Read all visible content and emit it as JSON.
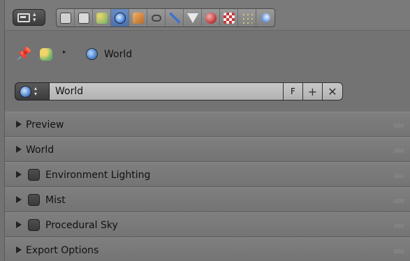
{
  "tabs": [
    {
      "name": "render-icon",
      "color": "#d7d7d7"
    },
    {
      "name": "render-layers-icon",
      "color": "#d7d7d7"
    },
    {
      "name": "scene-icon",
      "color": "#e6c04a"
    },
    {
      "name": "world-icon",
      "color": "#6aa7ff",
      "active": true
    },
    {
      "name": "object-icon",
      "color": "#e89a4a"
    },
    {
      "name": "constraints-icon",
      "color": "#c9c9c9"
    },
    {
      "name": "modifiers-icon",
      "color": "#4f7bcf"
    },
    {
      "name": "data-icon",
      "color": "#d7d7d7"
    },
    {
      "name": "material-icon",
      "color": "#c54"
    },
    {
      "name": "texture-icon",
      "color": "#c84040"
    },
    {
      "name": "particles-icon",
      "color": "#e1d34a"
    },
    {
      "name": "physics-icon",
      "color": "#7aa6ff"
    }
  ],
  "breadcrumb": {
    "label": "World"
  },
  "datablock": {
    "name": "World",
    "fake_user_label": "F",
    "add_icon": "+",
    "unlink_icon": "✕"
  },
  "panels": [
    {
      "label": "Preview",
      "has_checkbox": false
    },
    {
      "label": "World",
      "has_checkbox": false
    },
    {
      "label": "Environment Lighting",
      "has_checkbox": true
    },
    {
      "label": "Mist",
      "has_checkbox": true
    },
    {
      "label": "Procedural Sky",
      "has_checkbox": true
    },
    {
      "label": "Export Options",
      "has_checkbox": false
    }
  ]
}
